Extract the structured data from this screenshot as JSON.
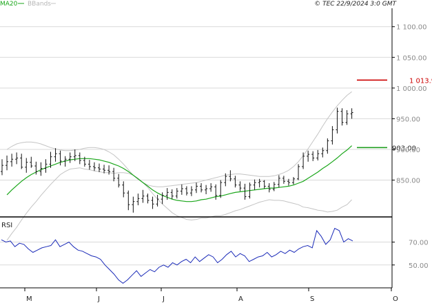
{
  "header": {
    "legend_ma_label": "MA20",
    "legend_bb_label": "BBands",
    "copyright": "© TEC 22/9/2024 3:0 GMT"
  },
  "colors": {
    "price_bar": "#111111",
    "ma": "#19a619",
    "bbands": "#c4c4c4",
    "resistance": "#cc0000",
    "support": "#1f9e1f",
    "rsi_line": "#1a2ab8",
    "grid": "#d9d9d9",
    "frame": "#000000"
  },
  "chart_data": {
    "type": "line",
    "price_panel": {
      "y_ticks": [
        {
          "value": 1100,
          "label": "1 100.00"
        },
        {
          "value": 1050,
          "label": "1 050.00"
        },
        {
          "value": 1000,
          "label": "1 000.00"
        },
        {
          "value": 950,
          "label": "950.00"
        },
        {
          "value": 900,
          "label": "900.00"
        },
        {
          "value": 850,
          "label": "850.00"
        }
      ],
      "resistance": {
        "value": 1013,
        "label": "1 013.9"
      },
      "support": {
        "value": 903,
        "label": "903.00"
      },
      "ohlc": [
        [
          864,
          884,
          858,
          874
        ],
        [
          874,
          890,
          866,
          880
        ],
        [
          880,
          893,
          872,
          884
        ],
        [
          884,
          895,
          876,
          886
        ],
        [
          886,
          893,
          868,
          871
        ],
        [
          871,
          886,
          862,
          879
        ],
        [
          879,
          888,
          870,
          873
        ],
        [
          873,
          880,
          859,
          864
        ],
        [
          864,
          879,
          857,
          869
        ],
        [
          869,
          884,
          862,
          876
        ],
        [
          876,
          896,
          870,
          888
        ],
        [
          888,
          902,
          880,
          893
        ],
        [
          893,
          898,
          874,
          881
        ],
        [
          881,
          889,
          872,
          884
        ],
        [
          884,
          895,
          878,
          888
        ],
        [
          888,
          900,
          881,
          890
        ],
        [
          890,
          895,
          876,
          882
        ],
        [
          882,
          888,
          872,
          876
        ],
        [
          876,
          883,
          867,
          872
        ],
        [
          872,
          879,
          865,
          870
        ],
        [
          870,
          877,
          863,
          868
        ],
        [
          868,
          875,
          861,
          866
        ],
        [
          866,
          874,
          859,
          864
        ],
        [
          864,
          870,
          848,
          853
        ],
        [
          853,
          860,
          838,
          842
        ],
        [
          842,
          848,
          822,
          829
        ],
        [
          829,
          833,
          801,
          810
        ],
        [
          810,
          823,
          797,
          815
        ],
        [
          815,
          828,
          809,
          820
        ],
        [
          820,
          834,
          813,
          824
        ],
        [
          824,
          828,
          812,
          817
        ],
        [
          817,
          823,
          803,
          811
        ],
        [
          811,
          826,
          807,
          819
        ],
        [
          819,
          830,
          811,
          825
        ],
        [
          825,
          837,
          818,
          830
        ],
        [
          830,
          835,
          819,
          824
        ],
        [
          824,
          837,
          820,
          832
        ],
        [
          832,
          843,
          826,
          836
        ],
        [
          836,
          840,
          825,
          829
        ],
        [
          829,
          840,
          824,
          834
        ],
        [
          834,
          846,
          829,
          840
        ],
        [
          840,
          845,
          830,
          834
        ],
        [
          834,
          842,
          827,
          836
        ],
        [
          836,
          845,
          831,
          839
        ],
        [
          839,
          843,
          818,
          825
        ],
        [
          825,
          850,
          821,
          846
        ],
        [
          846,
          861,
          840,
          856
        ],
        [
          856,
          866,
          848,
          852
        ],
        [
          852,
          857,
          838,
          842
        ],
        [
          842,
          848,
          832,
          837
        ],
        [
          837,
          844,
          818,
          823
        ],
        [
          823,
          846,
          820,
          842
        ],
        [
          842,
          851,
          834,
          846
        ],
        [
          846,
          852,
          838,
          848
        ],
        [
          848,
          850,
          836,
          840
        ],
        [
          840,
          845,
          830,
          835
        ],
        [
          835,
          847,
          832,
          843
        ],
        [
          843,
          858,
          838,
          853
        ],
        [
          853,
          857,
          844,
          848
        ],
        [
          848,
          852,
          841,
          846
        ],
        [
          846,
          855,
          843,
          852
        ],
        [
          852,
          876,
          850,
          872
        ],
        [
          872,
          895,
          868,
          889
        ],
        [
          889,
          898,
          880,
          892
        ],
        [
          892,
          897,
          881,
          886
        ],
        [
          886,
          899,
          882,
          893
        ],
        [
          893,
          903,
          887,
          898
        ],
        [
          898,
          918,
          893,
          914
        ],
        [
          914,
          938,
          908,
          932
        ],
        [
          932,
          968,
          926,
          962
        ],
        [
          962,
          967,
          939,
          944
        ],
        [
          944,
          964,
          940,
          958
        ],
        [
          958,
          967,
          950,
          960
        ]
      ],
      "ma20": [
        826,
        834,
        841,
        848,
        854,
        859,
        863,
        867,
        870,
        873,
        876,
        879,
        881,
        883,
        884,
        885,
        885,
        885,
        884,
        883,
        881,
        879,
        876,
        873,
        869,
        864,
        858,
        852,
        846,
        840,
        834,
        829,
        825,
        822,
        819,
        817,
        816,
        815,
        815,
        816,
        818,
        819,
        821,
        823,
        824,
        826,
        828,
        830,
        831,
        832,
        833,
        834,
        835,
        836,
        837,
        837,
        838,
        839,
        840,
        842,
        845,
        848,
        853,
        858,
        863,
        869,
        874,
        880,
        886,
        893,
        899,
        906
      ],
      "bb_upper": [
        900,
        905,
        909,
        911,
        912,
        912,
        911,
        909,
        906,
        903,
        901,
        899,
        898,
        898,
        899,
        900,
        902,
        903,
        903,
        902,
        900,
        896,
        891,
        884,
        876,
        867,
        858,
        851,
        846,
        842,
        840,
        839,
        839,
        840,
        841,
        842,
        843,
        844,
        845,
        846,
        848,
        850,
        852,
        854,
        856,
        858,
        859,
        860,
        860,
        859,
        858,
        857,
        856,
        856,
        856,
        857,
        859,
        862,
        866,
        872,
        880,
        890,
        901,
        913,
        925,
        938,
        950,
        961,
        971,
        980,
        988,
        994
      ],
      "bb_lower": [
        752,
        763,
        773,
        785,
        796,
        806,
        815,
        825,
        834,
        843,
        851,
        859,
        864,
        868,
        869,
        870,
        868,
        867,
        865,
        864,
        862,
        862,
        861,
        862,
        862,
        861,
        858,
        853,
        846,
        838,
        828,
        819,
        811,
        804,
        797,
        792,
        789,
        786,
        785,
        786,
        788,
        788,
        790,
        792,
        792,
        794,
        797,
        800,
        802,
        805,
        808,
        811,
        814,
        816,
        818,
        817,
        817,
        816,
        814,
        812,
        810,
        806,
        805,
        803,
        801,
        800,
        798,
        799,
        801,
        806,
        810,
        818
      ]
    },
    "rsi_panel": {
      "label": "RSI",
      "y_ticks": [
        {
          "value": 70,
          "label": "70.00"
        },
        {
          "value": 50,
          "label": "50.00"
        }
      ],
      "values": [
        72,
        70,
        71,
        66,
        69,
        68,
        64,
        61,
        63,
        65,
        66,
        67,
        72,
        66,
        68,
        70,
        66,
        63,
        62,
        60,
        58,
        57,
        55,
        50,
        46,
        42,
        37,
        34,
        37,
        41,
        45,
        40,
        43,
        46,
        44,
        48,
        50,
        48,
        52,
        50,
        53,
        55,
        52,
        57,
        53,
        56,
        59,
        57,
        52,
        55,
        59,
        62,
        57,
        60,
        58,
        53,
        55,
        57,
        58,
        61,
        57,
        59,
        62,
        60,
        63,
        61,
        64,
        66,
        67,
        65,
        80,
        75,
        68,
        72,
        82,
        80,
        70,
        73,
        71
      ]
    },
    "x_axis": {
      "labels": [
        "M",
        "J",
        "J",
        "A",
        "S",
        "O"
      ]
    }
  }
}
